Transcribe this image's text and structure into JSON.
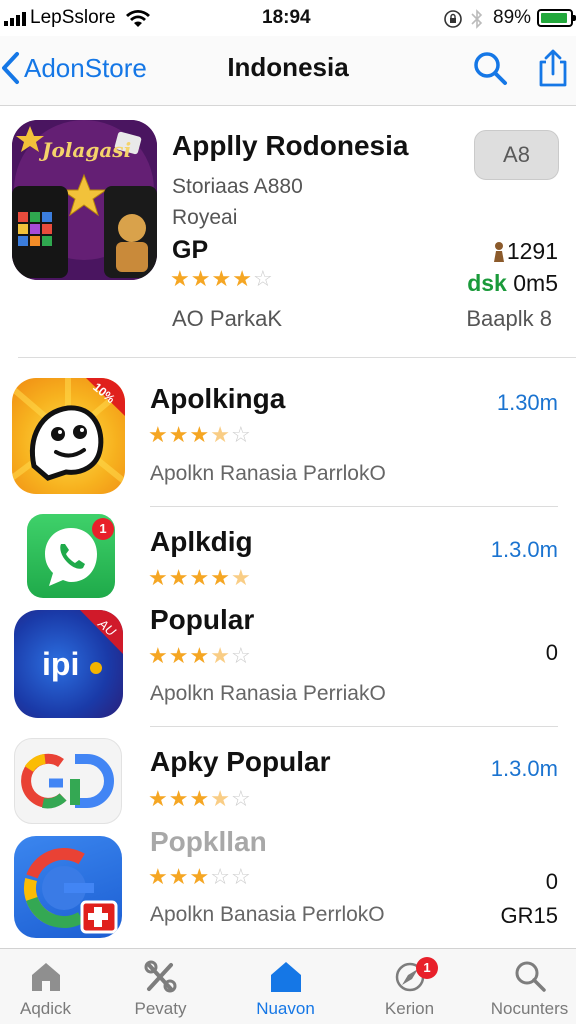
{
  "status_bar": {
    "carrier": "LepSslore",
    "time": "18:94",
    "battery_pct": "89%"
  },
  "nav": {
    "back_label": "AdonStore",
    "title": "Indonesia"
  },
  "featured": {
    "icon_text": "Jolagasi",
    "name": "Applly Rodonesia",
    "subtitle": "Storiaas A880",
    "subtitle2": "Royeai",
    "price": "GP",
    "rating": 4,
    "rating_count": "1291",
    "size_prefix": "dsk",
    "size": "0m5",
    "developer": "AO  ParkaK",
    "category": "Baaplk 8",
    "get_label": "A8"
  },
  "apps": [
    {
      "name": "Apolkinga",
      "rating": 3.5,
      "subtitle": "Apolkn Ranasia ParrlokO",
      "size": "1.30m",
      "corner": "10%"
    },
    {
      "name": "Aplkdig",
      "rating": 4.5,
      "size": "1.3.0m",
      "badge": "1"
    },
    {
      "name": "Popular",
      "rating": 3.5,
      "subtitle": "Apolkn Ranasia PerriakO",
      "value": "0",
      "corner": "AU",
      "icon_text": "ipi"
    },
    {
      "name": "Apky Popular",
      "rating": 3.5,
      "size": "1.3.0m"
    },
    {
      "name": "Popkllan",
      "rating": 3,
      "subtitle": "Apolkn Banasia PerrlokO",
      "value": "0",
      "value2": "GR15"
    }
  ],
  "tabs": [
    {
      "label": "Aqdick",
      "icon": "home-icon"
    },
    {
      "label": "Pevaty",
      "icon": "tools-icon"
    },
    {
      "label": "Nuavon",
      "icon": "house-fill-icon",
      "active": true
    },
    {
      "label": "Kerion",
      "icon": "compass-icon",
      "badge": "1"
    },
    {
      "label": "Nocunters",
      "icon": "search-icon"
    }
  ],
  "colors": {
    "accent": "#1577e6",
    "star": "#f5a623",
    "badge": "#e8202a",
    "battery": "#23a83c"
  }
}
